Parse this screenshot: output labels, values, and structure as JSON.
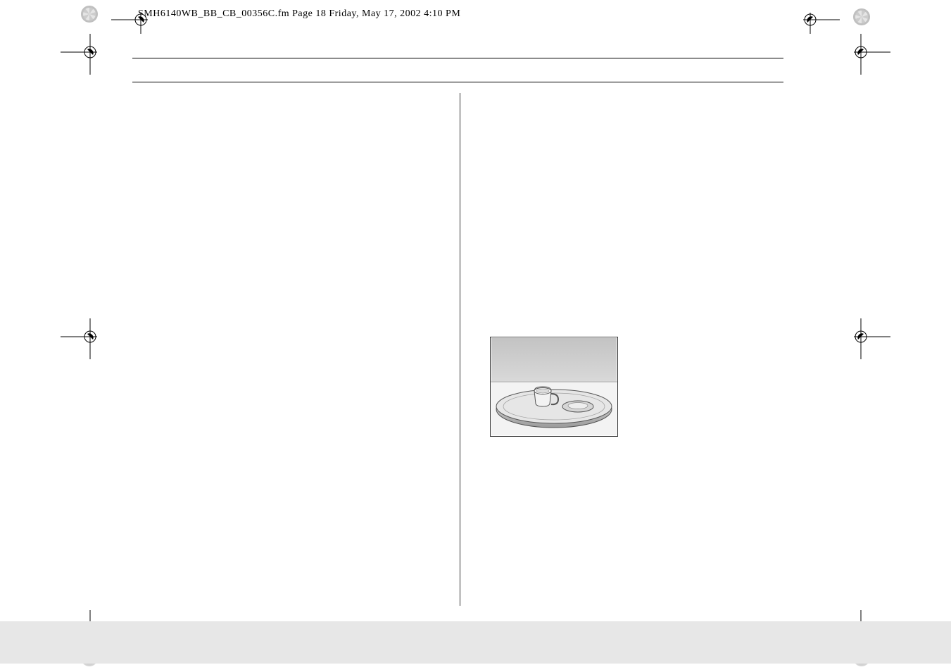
{
  "header": {
    "text": "SMH6140WB_BB_CB_00356C.fm  Page 18  Friday, May 17, 2002  4:10 PM"
  }
}
